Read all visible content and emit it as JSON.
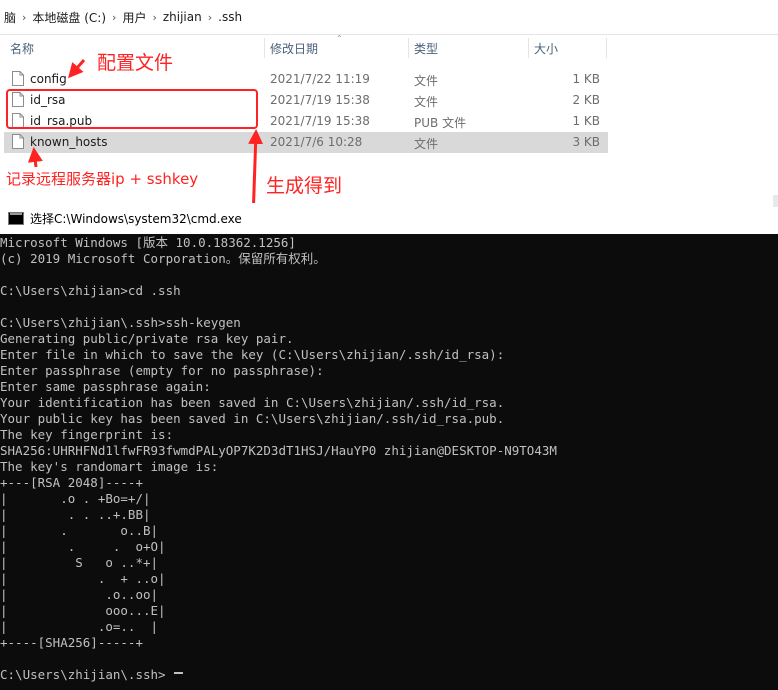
{
  "explorer": {
    "breadcrumb": [
      "脑",
      "本地磁盘 (C:)",
      "用户",
      "zhijian",
      ".ssh"
    ],
    "columns": {
      "name": "名称",
      "date": "修改日期",
      "type": "类型",
      "size": "大小"
    },
    "files": [
      {
        "name": "config",
        "date": "2021/7/22 11:19",
        "type": "文件",
        "size": "1 KB",
        "selected": false
      },
      {
        "name": "id_rsa",
        "date": "2021/7/19 15:38",
        "type": "文件",
        "size": "2 KB",
        "selected": false
      },
      {
        "name": "id_rsa.pub",
        "date": "2021/7/19 15:38",
        "type": "PUB 文件",
        "size": "1 KB",
        "selected": false
      },
      {
        "name": "known_hosts",
        "date": "2021/7/6 10:28",
        "type": "文件",
        "size": "3 KB",
        "selected": true
      }
    ]
  },
  "annotations": {
    "config_note": "配置文件",
    "known_hosts_note": "记录远程服务器ip + sshkey",
    "generated_note": "生成得到",
    "color": "#ff2222"
  },
  "cmd": {
    "title": "选择C:\\Windows\\system32\\cmd.exe",
    "lines": [
      "Microsoft Windows [版本 10.0.18362.1256]",
      "(c) 2019 Microsoft Corporation。保留所有权利。",
      "",
      "C:\\Users\\zhijian>cd .ssh",
      "",
      "C:\\Users\\zhijian\\.ssh>ssh-keygen",
      "Generating public/private rsa key pair.",
      "Enter file in which to save the key (C:\\Users\\zhijian/.ssh/id_rsa):",
      "Enter passphrase (empty for no passphrase):",
      "Enter same passphrase again:",
      "Your identification has been saved in C:\\Users\\zhijian/.ssh/id_rsa.",
      "Your public key has been saved in C:\\Users\\zhijian/.ssh/id_rsa.pub.",
      "The key fingerprint is:",
      "SHA256:UHRHFNd1lfwFR93fwmdPALyOP7K2D3dT1HSJ/HauYP0 zhijian@DESKTOP-N9TO43M",
      "The key's randomart image is:",
      "+---[RSA 2048]----+",
      "|       .o . +Bo=+/|",
      "|        . . ..+.BB|",
      "|       .       o..B|",
      "|        .     .  o+O|",
      "|         S   o ..*+|",
      "|            .  + ..o|",
      "|             .o..oo|",
      "|             ooo...E|",
      "|            .o=..  |",
      "+----[SHA256]-----+",
      "",
      "C:\\Users\\zhijian\\.ssh>"
    ]
  }
}
